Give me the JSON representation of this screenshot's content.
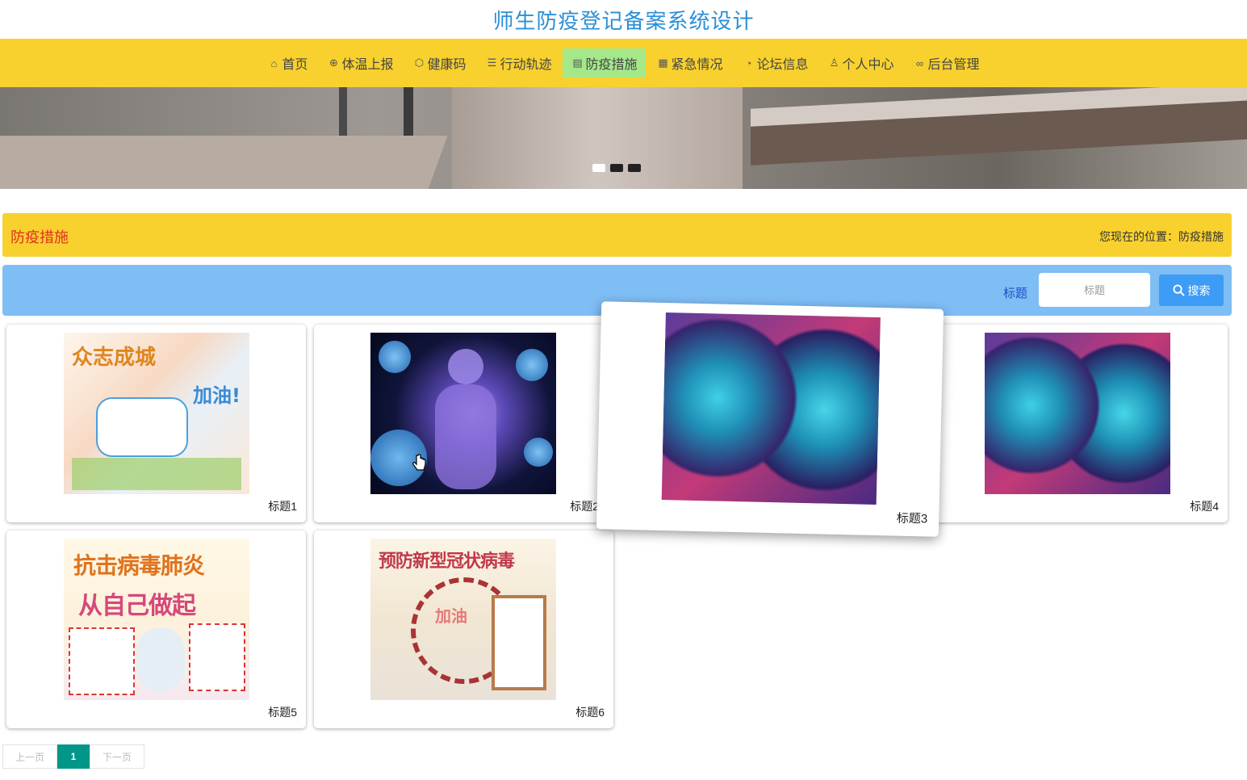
{
  "site": {
    "title": "师生防疫登记备案系统设计"
  },
  "nav": {
    "items": [
      {
        "label": "首页",
        "icon": "home-icon"
      },
      {
        "label": "体温上报",
        "icon": "globe-icon"
      },
      {
        "label": "健康码",
        "icon": "cube-icon"
      },
      {
        "label": "行动轨迹",
        "icon": "sliders-icon"
      },
      {
        "label": "防疫措施",
        "icon": "clipboard-icon",
        "active": true
      },
      {
        "label": "紧急情况",
        "icon": "grid-icon"
      },
      {
        "label": "论坛信息",
        "icon": "gauge-icon"
      },
      {
        "label": "个人中心",
        "icon": "user-icon"
      },
      {
        "label": "后台管理",
        "icon": "link-icon"
      }
    ],
    "active_color": "#a5e88a",
    "bar_color": "#f8d12f"
  },
  "carousel": {
    "active_index": 0,
    "count": 3
  },
  "section": {
    "title": "防疫措施",
    "breadcrumb": "您现在的位置：防疫措施"
  },
  "search": {
    "label": "标题",
    "placeholder": "标题",
    "button": "搜索"
  },
  "cards": [
    {
      "caption": "标题1",
      "poster_text": [
        "众志成城",
        "加油!"
      ]
    },
    {
      "caption": "标题2"
    },
    {
      "caption": "标题3"
    },
    {
      "caption": "标题4"
    },
    {
      "caption": "标题5",
      "poster_text": [
        "抗击病毒肺炎",
        "从自己做起"
      ]
    },
    {
      "caption": "标题6",
      "poster_text": [
        "预防新型冠状病毒",
        "加油"
      ]
    }
  ],
  "pagination": {
    "prev": "上一页",
    "current": "1",
    "next": "下一页"
  }
}
